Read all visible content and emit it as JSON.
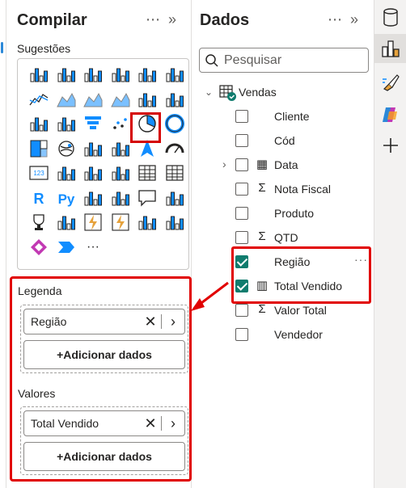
{
  "build_pane": {
    "title": "Compilar",
    "more_icon": "ellipsis-icon",
    "collapse_icon": "double-chevron-right-icon",
    "suggestions_label": "Sugestões",
    "selected_visual": "pie-chart",
    "more_visuals": "···"
  },
  "wells": [
    {
      "label": "Legenda",
      "field": "Região",
      "add_label": "+Adicionar dados"
    },
    {
      "label": "Valores",
      "field": "Total Vendido",
      "add_label": "+Adicionar dados"
    }
  ],
  "data_pane": {
    "title": "Dados",
    "search_placeholder": "Pesquisar",
    "table": "Vendas",
    "fields": [
      {
        "name": "Cliente",
        "checked": false,
        "icon": ""
      },
      {
        "name": "Cód",
        "checked": false,
        "icon": ""
      },
      {
        "name": "Data",
        "checked": false,
        "icon": "calendar-icon",
        "expandable": true
      },
      {
        "name": "Nota Fiscal",
        "checked": false,
        "icon": "sigma-icon"
      },
      {
        "name": "Produto",
        "checked": false,
        "icon": ""
      },
      {
        "name": "QTD",
        "checked": false,
        "icon": "sigma-icon"
      },
      {
        "name": "Região",
        "checked": true,
        "icon": "",
        "more": "···"
      },
      {
        "name": "Total Vendido",
        "checked": true,
        "icon": "calculator-icon"
      },
      {
        "name": "Valor Total",
        "checked": false,
        "icon": "sigma-icon"
      },
      {
        "name": "Vendedor",
        "checked": false,
        "icon": ""
      }
    ]
  },
  "rail": [
    "data-cylinder-icon",
    "build-visual-icon",
    "format-brush-icon",
    "copilot-icon",
    "add-icon"
  ],
  "colors": {
    "highlight": "#e10000",
    "check": "#107c6e",
    "accent": "#118dff"
  }
}
